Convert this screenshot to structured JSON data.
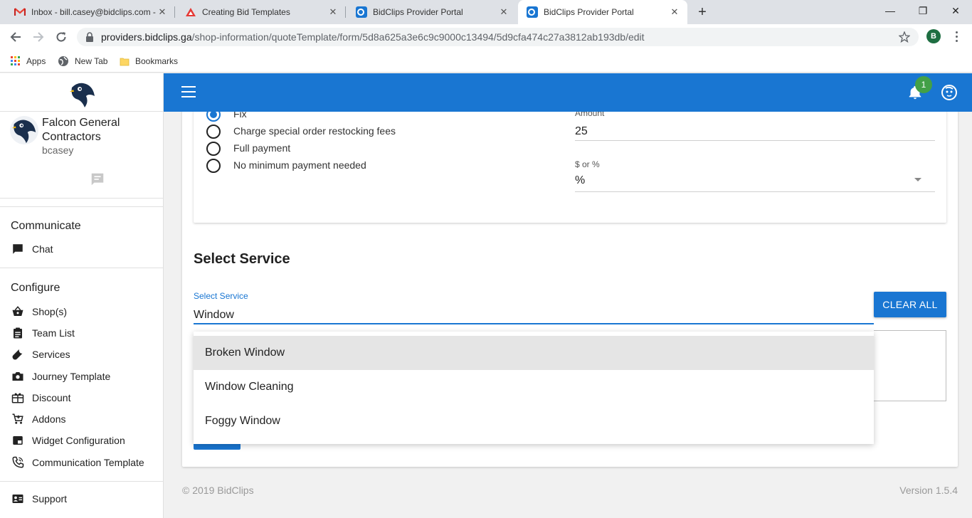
{
  "browser": {
    "tabs": [
      {
        "title": "Inbox - bill.casey@bidclips.com - ",
        "icon": "gmail-icon"
      },
      {
        "title": "Creating Bid Templates",
        "icon": "template-site-icon"
      },
      {
        "title": "BidClips Provider Portal",
        "icon": "bidclips-icon"
      },
      {
        "title": "BidClips Provider Portal",
        "icon": "bidclips-icon",
        "active": true
      }
    ],
    "new_tab_label": "+",
    "window_controls": {
      "minimize": "—",
      "maximize": "❐",
      "close": "✕"
    },
    "url_host": "providers.bidclips.ga",
    "url_path": "/shop-information/quoteTemplate/form/5d8a625a3e6c9c9000c13494/5d9cfa474c27a3812ab193db/edit",
    "profile_initial": "B",
    "bookmarks": [
      {
        "label": "Apps",
        "icon": "apps-grid-icon"
      },
      {
        "label": "New Tab",
        "icon": "globe-icon"
      },
      {
        "label": "Bookmarks",
        "icon": "folder-icon"
      }
    ]
  },
  "sidebar": {
    "org_name": "Falcon General Contractors",
    "username": "bcasey",
    "sections": [
      {
        "title": "Communicate",
        "items": [
          {
            "label": "Chat",
            "icon": "chat-icon"
          }
        ]
      },
      {
        "title": "Configure",
        "items": [
          {
            "label": "Shop(s)",
            "icon": "basket-icon"
          },
          {
            "label": "Team List",
            "icon": "clipboard-icon"
          },
          {
            "label": "Services",
            "icon": "wrench-icon"
          },
          {
            "label": "Journey Template",
            "icon": "camera-icon"
          },
          {
            "label": "Discount",
            "icon": "gift-icon"
          },
          {
            "label": "Addons",
            "icon": "cart-add-icon"
          },
          {
            "label": "Widget Configuration",
            "icon": "widget-icon"
          },
          {
            "label": "Communication Template",
            "icon": "phone-icon"
          }
        ]
      },
      {
        "title": "",
        "items": [
          {
            "label": "Support",
            "icon": "contact-card-icon"
          }
        ]
      }
    ]
  },
  "header": {
    "notification_count": "1"
  },
  "payment": {
    "options": [
      {
        "label": "Fix",
        "selected": true
      },
      {
        "label": "Charge special order restocking fees",
        "selected": false
      },
      {
        "label": "Full payment",
        "selected": false
      },
      {
        "label": "No minimum payment needed",
        "selected": false
      }
    ],
    "amount_label": "Amount",
    "amount_value": "25",
    "unit_label": "$ or %",
    "unit_value": "%"
  },
  "select_service": {
    "section_title": "Select Service",
    "field_label": "Select Service",
    "input_value": "Window",
    "clear_label": "CLEAR ALL",
    "suggestions": [
      "Broken Window",
      "Window Cleaning",
      "Foggy Window"
    ],
    "highlighted_index": 0
  },
  "footer": {
    "copyright": "© 2019 BidClips",
    "version": "Version 1.5.4"
  },
  "colors": {
    "primary": "#1976d2",
    "badge": "#43a047"
  }
}
